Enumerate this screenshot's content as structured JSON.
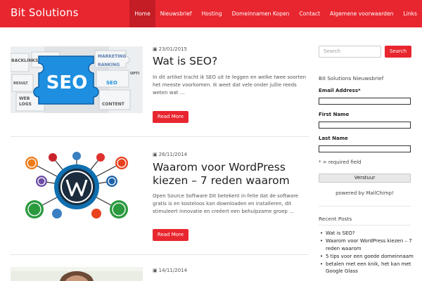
{
  "header": {
    "brand": "Bit Solutions",
    "nav": [
      "Home",
      "Nieuwsbrief",
      "Hosting",
      "Domeinnamen Kopen",
      "Contact",
      "Algemene voorwaarden",
      "Links"
    ],
    "active": "Home",
    "accent_color": "#e8262f"
  },
  "posts": [
    {
      "date": "23/01/2015",
      "title": "Wat is SEO?",
      "excerpt": "In dit artikel tracht ik SEO uit te leggen en welke twee soorten het meeste voorkomen. Ik weet dat vele onder jullie reeds weten wat …",
      "button": "Read More",
      "thumb_words": [
        "SEO",
        "BACKLINKS",
        "MARKETING",
        "RANKING",
        "RESULT",
        "WEB",
        "LOGS",
        "CONTENT",
        "OPTI",
        "SEO"
      ]
    },
    {
      "date": "26/11/2014",
      "title": "Waarom voor WordPress kiezen – 7 reden waarom",
      "excerpt": "Open Source Software Dit betekent in feite dat de software gratis is en kosteloos kan downloaden en installeren, dit stimuleert innovatie en creëert een behulpzame groep …",
      "button": "Read More"
    },
    {
      "date": "14/11/2014"
    }
  ],
  "sidebar": {
    "search": {
      "placeholder": "Search",
      "button": "Search"
    },
    "newsletter": {
      "heading": "Bit Solutions Nieuwsbrief",
      "email_label": "Email Address*",
      "first_name_label": "First Name",
      "last_name_label": "Last Name",
      "required_note": "* = required field",
      "submit": "Verstuur",
      "powered": "powered by MailChimp!"
    },
    "recent": {
      "heading": "Recent Posts",
      "items": [
        "Wat is SEO?",
        "Waarom voor WordPress kiezen – 7 reden waarom",
        "5 tips voor een goede domeinnaam",
        "betalen met een knik, het kan met Google Glass"
      ]
    }
  }
}
